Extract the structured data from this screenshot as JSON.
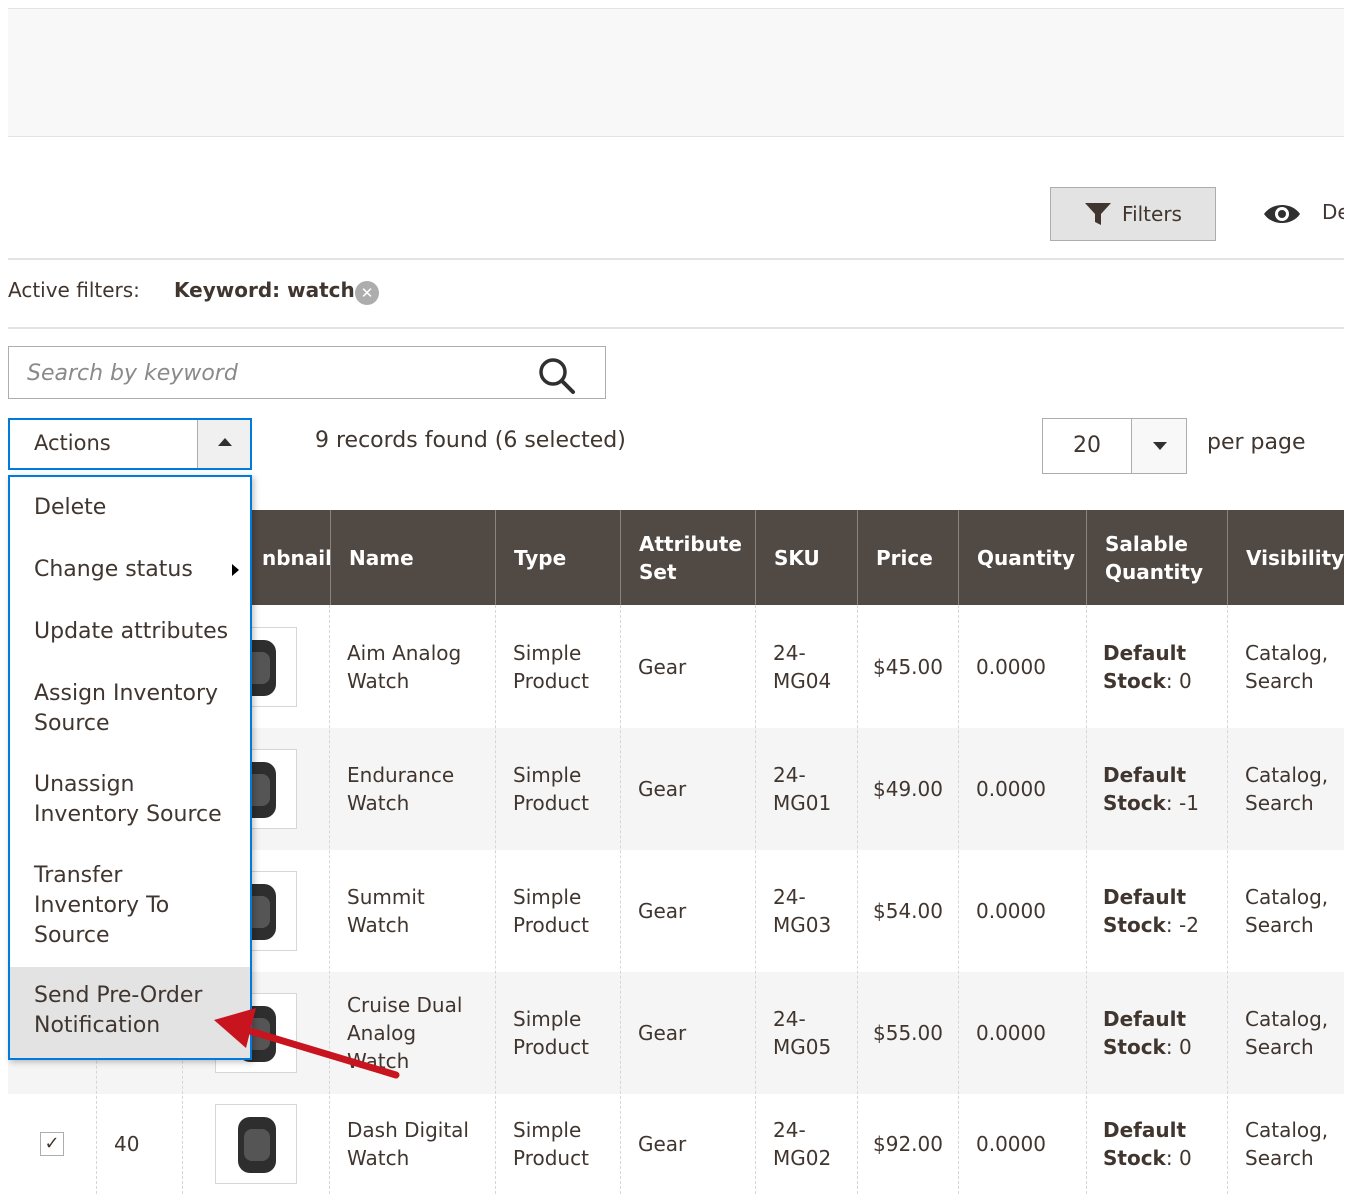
{
  "toolbar": {
    "filters_label": "Filters",
    "view_label": "De"
  },
  "active_filters": {
    "label": "Active filters:",
    "keyword": "Keyword: watch"
  },
  "search": {
    "placeholder": "Search by keyword"
  },
  "actions": {
    "label": "Actions",
    "menu": [
      {
        "label": "Delete"
      },
      {
        "label": "Change status"
      },
      {
        "label": "Update attributes"
      },
      {
        "label": "Assign Inventory\nSource"
      },
      {
        "label": "Unassign\nInventory Source"
      },
      {
        "label": "Transfer\nInventory To\nSource"
      },
      {
        "label": "Send Pre-Order\nNotification"
      }
    ]
  },
  "records_text": "9 records found (6 selected)",
  "pager": {
    "per_page_value": "20",
    "per_page_label": "per page"
  },
  "grid": {
    "columns": [
      "nbnail",
      "Name",
      "Type",
      "Attribute\nSet",
      "SKU",
      "Price",
      "Quantity",
      "Salable\nQuantity",
      "Visibility"
    ],
    "rows": [
      {
        "name": "Aim Analog\nWatch",
        "type": "Simple\nProduct",
        "attr_set": "Gear",
        "sku": "24-\nMG04",
        "price": "$45.00",
        "qty": "0.0000",
        "salable_label": "Default\nStock",
        "salable_value": ": 0",
        "visibility": "Catalog,\nSearch"
      },
      {
        "name": "Endurance\nWatch",
        "type": "Simple\nProduct",
        "attr_set": "Gear",
        "sku": "24-\nMG01",
        "price": "$49.00",
        "qty": "0.0000",
        "salable_label": "Default\nStock",
        "salable_value": ": -1",
        "visibility": "Catalog,\nSearch"
      },
      {
        "name": "Summit\nWatch",
        "type": "Simple\nProduct",
        "attr_set": "Gear",
        "sku": "24-\nMG03",
        "price": "$54.00",
        "qty": "0.0000",
        "salable_label": "Default\nStock",
        "salable_value": ": -2",
        "visibility": "Catalog,\nSearch"
      },
      {
        "name": "Cruise Dual\nAnalog\nWatch",
        "type": "Simple\nProduct",
        "attr_set": "Gear",
        "sku": "24-\nMG05",
        "price": "$55.00",
        "qty": "0.0000",
        "salable_label": "Default\nStock",
        "salable_value": ": 0",
        "visibility": "Catalog,\nSearch"
      },
      {
        "id": "40",
        "checked": "✓",
        "name": "Dash Digital\nWatch",
        "type": "Simple\nProduct",
        "attr_set": "Gear",
        "sku": "24-\nMG02",
        "price": "$92.00",
        "qty": "0.0000",
        "salable_label": "Default\nStock",
        "salable_value": ": 0",
        "visibility": "Catalog,\nSearch"
      }
    ]
  },
  "colors": {
    "header_bg": "#514943",
    "accent_blue": "#007bdb",
    "annotation_arrow": "#c8141e",
    "row_stripe": "#f5f5f5"
  }
}
